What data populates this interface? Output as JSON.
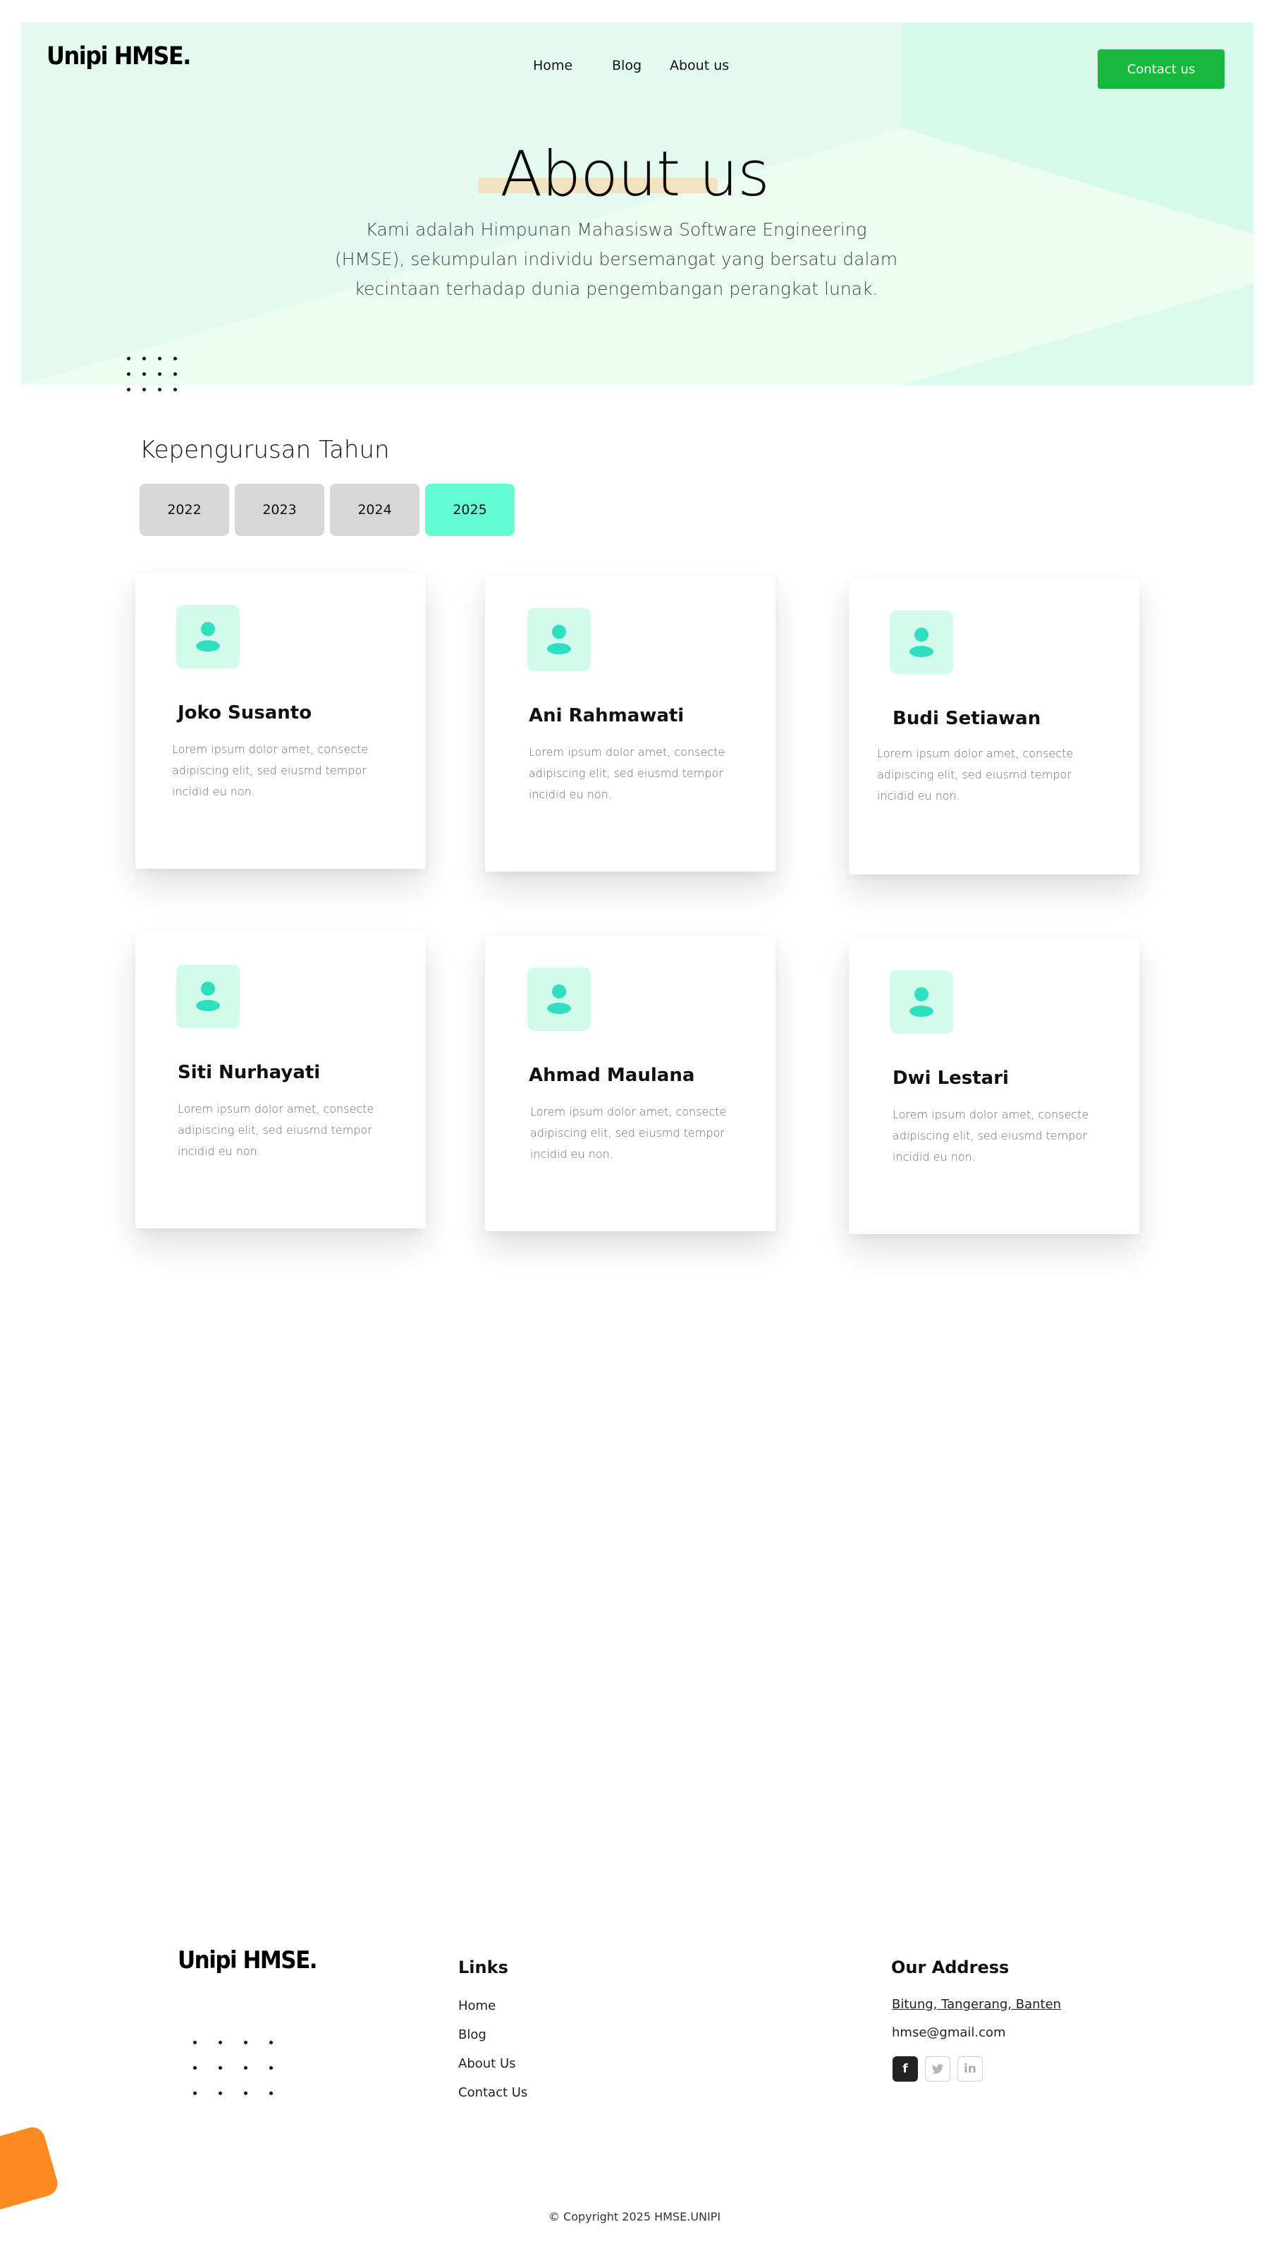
{
  "brand": {
    "logo": "Unipi HMSE."
  },
  "nav": {
    "items": [
      "Home",
      "Blog",
      "About us"
    ],
    "contact_label": "Contact us"
  },
  "hero": {
    "title": "About us",
    "description": "Kami adalah Himpunan Mahasiswa Software Engineering (HMSE), sekumpulan individu bersemangat yang bersatu dalam kecintaan terhadap dunia pengembangan perangkat lunak."
  },
  "management": {
    "title": "Kepengurusan Tahun",
    "tabs": [
      "2022",
      "2023",
      "2024",
      "2025"
    ],
    "active_tab": "2025",
    "members": [
      {
        "name": "Joko Susanto",
        "description": "Lorem ipsum dolor amet, consecte adipiscing elit, sed eiusmd tempor incidid eu non."
      },
      {
        "name": "Ani Rahmawati",
        "description": "Lorem ipsum dolor amet, consecte adipiscing elit, sed eiusmd tempor incidid eu non."
      },
      {
        "name": "Budi Setiawan",
        "description": "Lorem ipsum dolor amet, consecte adipiscing elit, sed eiusmd tempor incidid eu non."
      },
      {
        "name": "Siti Nurhayati",
        "description": "Lorem ipsum dolor amet, consecte adipiscing elit, sed eiusmd tempor incidid eu non."
      },
      {
        "name": "Ahmad Maulana",
        "description": "Lorem ipsum dolor amet, consecte adipiscing elit, sed eiusmd tempor incidid eu non."
      },
      {
        "name": "Dwi Lestari",
        "description": "Lorem ipsum dolor amet, consecte adipiscing elit, sed eiusmd tempor incidid eu non."
      }
    ]
  },
  "footer": {
    "logo": "Unipi HMSE.",
    "links_title": "Links",
    "links": [
      "Home",
      "Blog",
      "About Us",
      "Contact Us"
    ],
    "address_title": "Our Address",
    "address": "Bitung, Tangerang, Banten",
    "email": "hmse@gmail.com",
    "social": [
      {
        "icon": "facebook-icon",
        "glyph": "f"
      },
      {
        "icon": "twitter-icon",
        "glyph": "t"
      },
      {
        "icon": "linkedin-icon",
        "glyph": "in"
      }
    ],
    "copyright": "© Copyright 2025 HMSE.UNIPI"
  },
  "colors": {
    "hero_bg": "#e3fbef",
    "accent_green": "#17b93d",
    "active_tab": "#64fcd2",
    "avatar_bg": "#d3fbeb",
    "avatar_icon": "#2ee0c1",
    "decor_orange": "#fc8a20"
  }
}
